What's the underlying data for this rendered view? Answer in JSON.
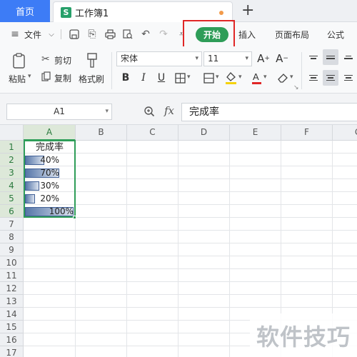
{
  "tabs": {
    "home": "首页",
    "document": "工作簿1",
    "doc_icon": "S",
    "new_tab": "+"
  },
  "menu": {
    "file": "文件",
    "start": "开始",
    "insert": "插入",
    "page_layout": "页面布局",
    "formula": "公式"
  },
  "ribbon": {
    "paste": "粘贴",
    "cut": "剪切",
    "copy": "复制",
    "format_painter": "格式刷",
    "font_name": "宋体",
    "font_size": "11",
    "bold": "B",
    "italic": "I",
    "underline": "U"
  },
  "formula_bar": {
    "name_box": "A1",
    "fx": "fx",
    "content": "完成率"
  },
  "columns": [
    "A",
    "B",
    "C",
    "D",
    "E",
    "F",
    "G"
  ],
  "rows": [
    "1",
    "2",
    "3",
    "4",
    "5",
    "6",
    "7",
    "8",
    "9",
    "10",
    "11",
    "12",
    "13",
    "14",
    "15",
    "16",
    "17"
  ],
  "cells": {
    "a1": "完成率",
    "a2": "40%",
    "a3": "70%",
    "a4": "30%",
    "a5": "20%",
    "a6": "100%"
  },
  "data_bars": {
    "a2": 0.4,
    "a3": 0.7,
    "a4": 0.3,
    "a5": 0.2,
    "a6": 1.0
  },
  "watermark": "软件技巧",
  "colors": {
    "accent": "#2e9d58",
    "home_tab": "#3d7cf6",
    "highlight": "#e02626",
    "data_bar": "#5676a8"
  }
}
